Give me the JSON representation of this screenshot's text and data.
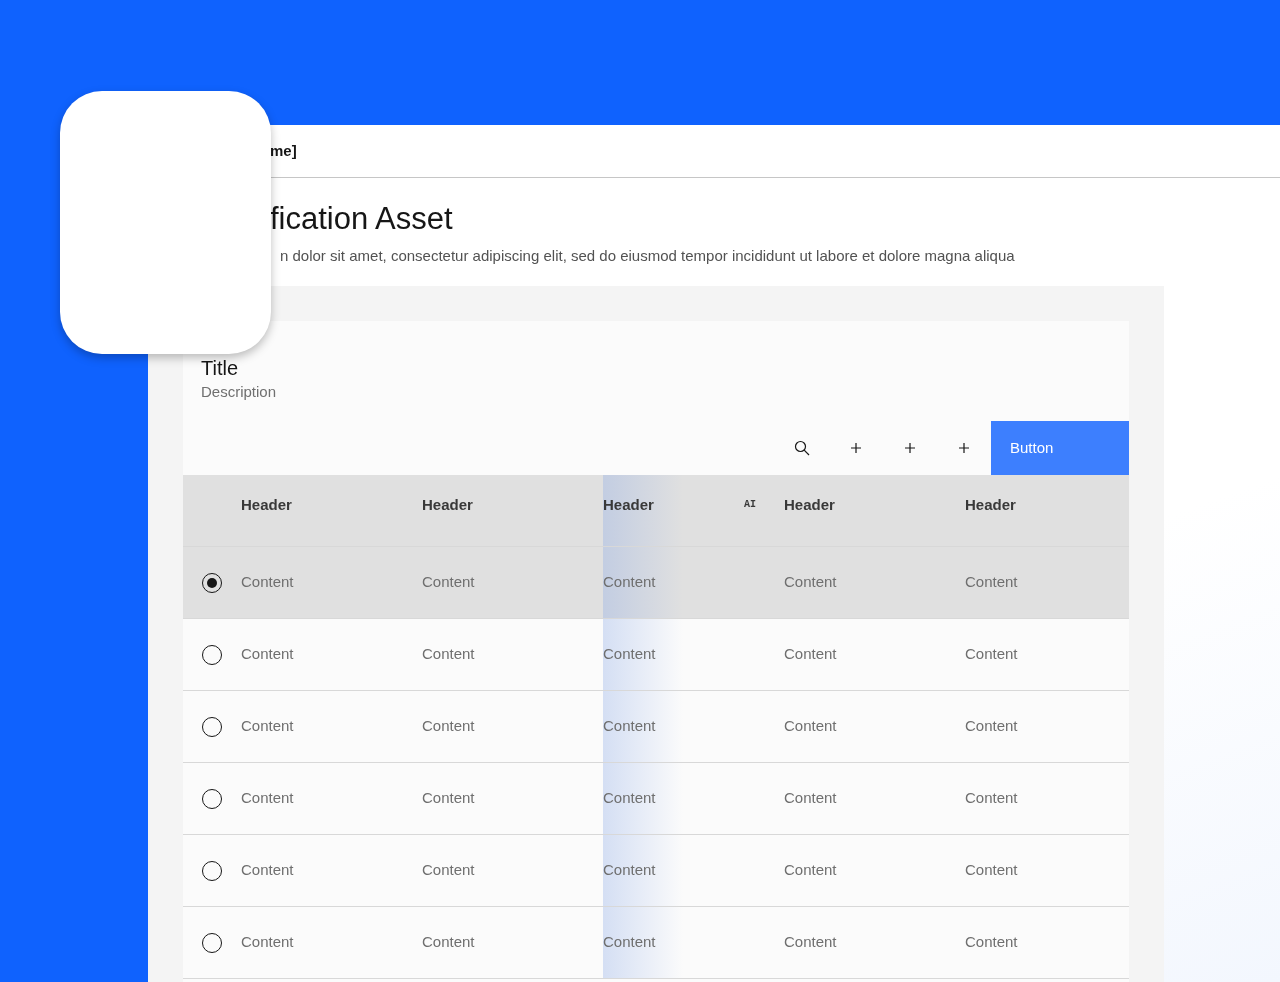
{
  "header": {
    "title": "me]"
  },
  "page": {
    "title": "fication Asset",
    "description": "n dolor sit amet, consectetur adipiscing elit, sed do eiusmod tempor incididunt ut labore et dolore magna aliqua"
  },
  "card": {
    "title": "Title",
    "description": "Description"
  },
  "toolbar": {
    "button": "Button"
  },
  "table": {
    "columns": [
      {
        "label": "Header"
      },
      {
        "label": "Header"
      },
      {
        "label": "Header",
        "ai_label": "AI"
      },
      {
        "label": "Header"
      },
      {
        "label": "Header"
      }
    ],
    "rows": [
      {
        "selected": true,
        "cells": [
          "Content",
          "Content",
          "Content",
          "Content",
          "Content"
        ]
      },
      {
        "selected": false,
        "cells": [
          "Content",
          "Content",
          "Content",
          "Content",
          "Content"
        ]
      },
      {
        "selected": false,
        "cells": [
          "Content",
          "Content",
          "Content",
          "Content",
          "Content"
        ]
      },
      {
        "selected": false,
        "cells": [
          "Content",
          "Content",
          "Content",
          "Content",
          "Content"
        ]
      },
      {
        "selected": false,
        "cells": [
          "Content",
          "Content",
          "Content",
          "Content",
          "Content"
        ]
      },
      {
        "selected": false,
        "cells": [
          "Content",
          "Content",
          "Content",
          "Content",
          "Content"
        ]
      }
    ]
  }
}
